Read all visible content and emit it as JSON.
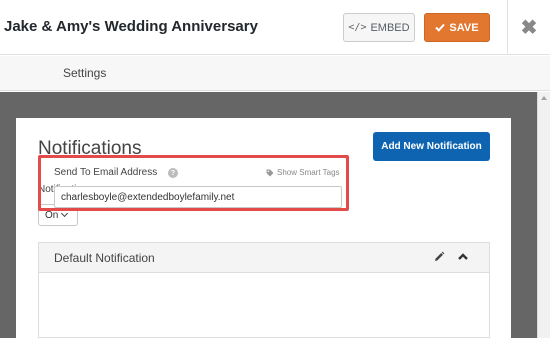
{
  "header": {
    "form_title": "Jake & Amy's Wedding Anniversary",
    "embed_label": "EMBED",
    "save_label": "SAVE",
    "close_glyph": "✖"
  },
  "tabs": [
    {
      "label": "Settings"
    }
  ],
  "panel": {
    "title": "Notifications",
    "add_button_label": "Add New Notification",
    "notifications_label": "Notifications",
    "notifications_select_value": "On"
  },
  "notification": {
    "title": "Default Notification",
    "email_field_label": "Send To Email Address",
    "help_glyph": "?",
    "smart_tags_label": "Show Smart Tags",
    "email_value": "charlesboyle@extendedboylefamily.net"
  },
  "colors": {
    "save_button": "#e27730",
    "add_button": "#0e64b0",
    "highlight": "#e34b4b",
    "canvas_bg": "#666666"
  },
  "icons": {
    "embed": "code-icon",
    "save": "check-icon",
    "close": "close-icon",
    "edit": "pencil-icon",
    "collapse": "chevron-up-icon",
    "help": "help-icon",
    "smart_tags": "tag-icon"
  }
}
